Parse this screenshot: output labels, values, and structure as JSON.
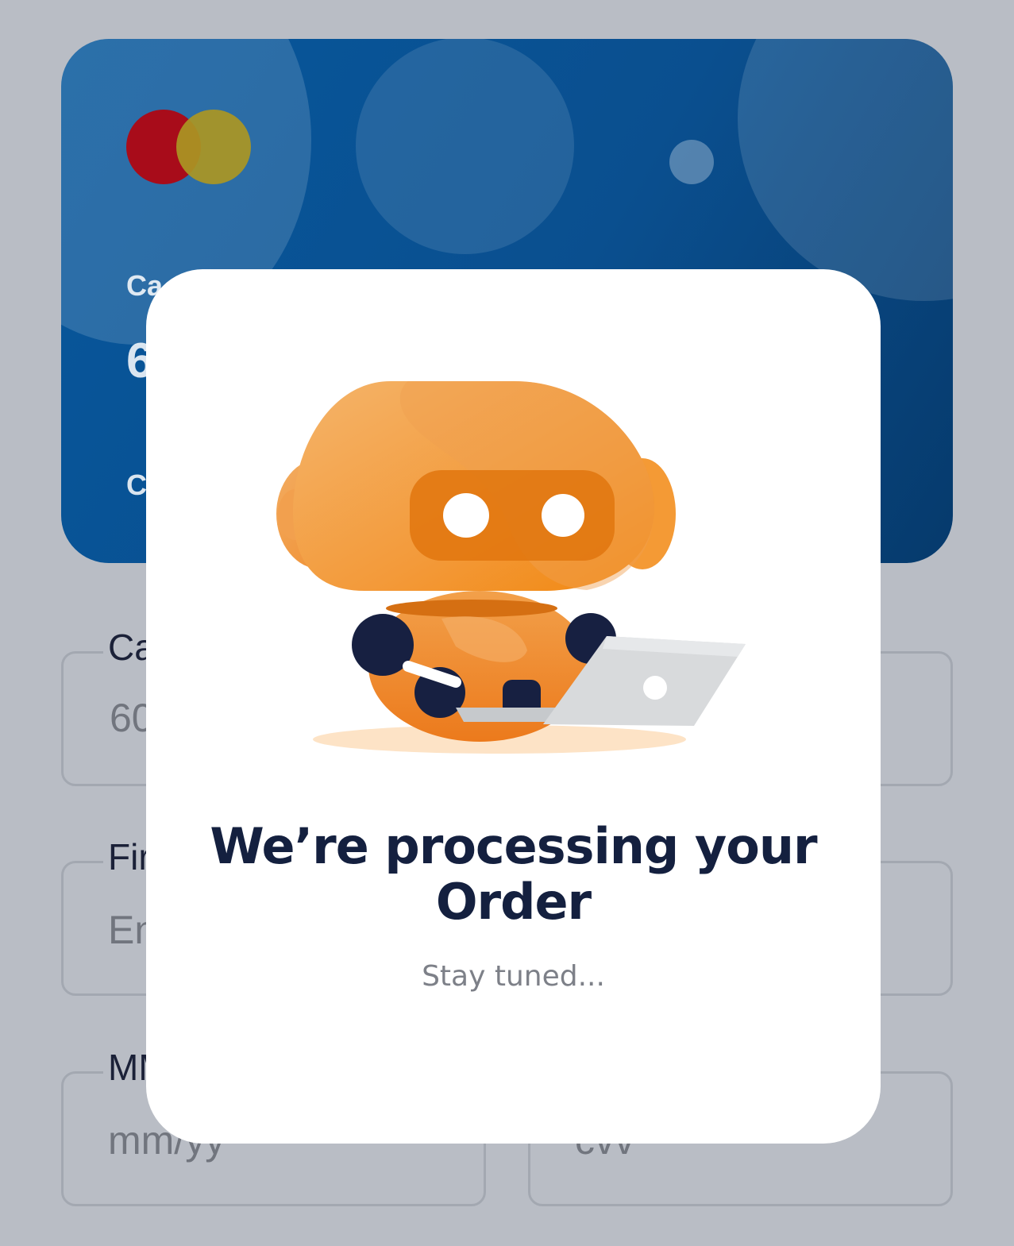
{
  "colors": {
    "backdrop": "#b9bdc5",
    "card_blue": "#07579c",
    "brand_red": "#a80c1a",
    "brand_yellow": "#aa9623",
    "robot_orange": "#f39a3a",
    "title_navy": "#14203f"
  },
  "card": {
    "logo_icon": "mastercard-logo",
    "label_fragment": "Ca",
    "number_fragment": "6",
    "cvv_fragment": "C"
  },
  "form": {
    "card_number": {
      "label": "Ca",
      "value": "60"
    },
    "first_name": {
      "label": "Fir",
      "placeholder": "En"
    },
    "expiry": {
      "label": "MM",
      "placeholder": "mm/yy"
    },
    "cvv": {
      "placeholder": "cvv"
    }
  },
  "modal": {
    "illustration_icon": "robot-with-laptop",
    "title": "We’re processing your Order",
    "subtitle": "Stay tuned..."
  }
}
